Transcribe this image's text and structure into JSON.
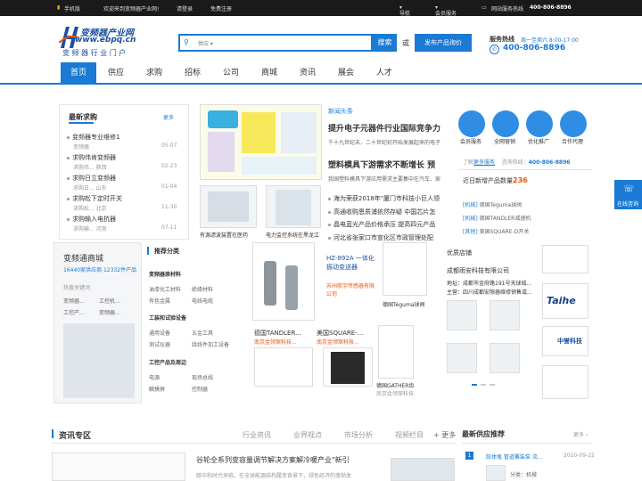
{
  "topbar": {
    "mobile": "手机版",
    "welcome": "欢迎来到变频器产业网!",
    "login": "请登录",
    "register": "免费注册",
    "nav": "导航",
    "member": "会员服务",
    "hotline_label": "网站服务热线",
    "hotline": "400-806-8896"
  },
  "logo": {
    "url": "www.ebpq.cn",
    "name": "变频器产业网",
    "slogan": "变 频 器 行 业 门 户"
  },
  "search": {
    "category": "供应",
    "button": "搜索",
    "or": "或",
    "publish": "发布产品询价"
  },
  "service": {
    "label": "服务热线",
    "hours": "周一至周六 8:00-17:00",
    "phone": "400-806-8896"
  },
  "nav": [
    "首页",
    "供应",
    "求购",
    "招标",
    "公司",
    "商城",
    "资讯",
    "展会",
    "人才"
  ],
  "latest_buy": {
    "title": "最新求购",
    "more": "更多",
    "items": [
      {
        "t": "变频器专业维修1",
        "s": "变频器",
        "d": "05-07"
      },
      {
        "t": "求购伟肯变频器",
        "s": "求购伟...  陕西",
        "d": "02-23"
      },
      {
        "t": "求购日立变频器",
        "s": "求购日...  山东",
        "d": "01-04"
      },
      {
        "t": "求购松下定时开关",
        "s": "求购松...  北京",
        "d": "11-30"
      },
      {
        "t": "求购输入电抗器",
        "s": "求购输...  河南",
        "d": "07-11"
      }
    ]
  },
  "center_imgs": [
    {
      "cap": "有源滤波装置在医药"
    },
    {
      "cap": "电力监控系统在黑龙江"
    }
  ],
  "headline": {
    "title": "新闻头条",
    "h1": "提升电子元器件行业国际竞争力",
    "h1s": "千十九世纪末，二十世纪初开始发展起来的电子",
    "h2": "塑料模具下游需求不断增长 预",
    "h2s": "我国塑料模具下游应用需求主要集中在汽车、家",
    "list": [
      "海为荣获2018年\"厦门市科技小巨人领",
      "高通收购恩质浦依然存疑 中国芯片怎",
      "晶电蓝光产品价格承压 提高四元产品",
      "河北省张家口市宣化区市政管理处配"
    ]
  },
  "services": [
    {
      "n": "会员服务"
    },
    {
      "n": "全网营销"
    },
    {
      "n": "优化推广"
    },
    {
      "n": "合作代理"
    }
  ],
  "more_service": {
    "pre": "了解",
    "link": "更多服务",
    "mid": "咨询热线：",
    "phone": "400-806-8896"
  },
  "new_products": {
    "label": "近日新增产品数量",
    "count": "236",
    "items": [
      {
        "tag": "[机械]",
        "t": "德国Teguma球阀"
      },
      {
        "tag": "[机械]",
        "t": "德国TANDLER减速机"
      },
      {
        "tag": "[其他]",
        "t": "美国SQUARE-D开关"
      }
    ]
  },
  "mall": {
    "title": "变频通商城",
    "stats": "16440家供应商  12332件产品",
    "hot_label": "热搜关键词",
    "hot": [
      "变频器...",
      "工控机...",
      "工控产...",
      "变频器..."
    ]
  },
  "recommend": {
    "title": "推荐分类",
    "groups": [
      {
        "name": "变频器原材料",
        "items": [
          "油漆化工材料",
          "绝缘材料",
          "有色金属",
          "电线电缆"
        ]
      },
      {
        "name": "工装和试验设备",
        "items": [
          "通用设备",
          "五金工具",
          "测试仪器",
          "绕线件加工设备"
        ]
      },
      {
        "name": "工控产品及周边",
        "items": [
          "电源",
          "现场总线",
          "触摸屏",
          "控制器"
        ]
      }
    ]
  },
  "products": [
    {
      "t": "HZ-892A 一体化振动变送器",
      "s": "苏州航宇传感器有限公司"
    },
    {
      "t": "德国Teguma球阀",
      "s": ""
    },
    {
      "t": "德国TANDLER...",
      "s": "南京金领琛科技..."
    },
    {
      "t": "美国SQUARE-...",
      "s": "南京金领琛科技..."
    },
    {
      "t": "德国GATHER齿",
      "s": "南京金领琛科技"
    }
  ],
  "quality": {
    "title": "优质店铺",
    "name": "成都雨安科技有限公司",
    "addr": "地址：成都市金府路191号天球城...",
    "biz": "主营：四川成都安限器维修销售或..."
  },
  "logos": [
    {
      "name": "Taihe"
    },
    {
      "name": "中誉科技"
    }
  ],
  "news": {
    "title": "资讯专区",
    "tabs": [
      "行业资讯",
      "业界视点",
      "市场分析",
      "视频栏目"
    ],
    "more": "+ 更多",
    "headline": "谷轮全系列变容量调节解决方案解冷暖产业\"新引",
    "sub": "碳中和时代来临，在全球能源结构履变背景下，绿色经济的蓬勃发"
  },
  "rec_supply": {
    "title": "最新供应推荐",
    "more": "更多",
    "item": "胶体瓶 管道雕装泵 流...",
    "date": "2020-09-22",
    "cat": "分类：机械"
  },
  "float": {
    "label": "在线咨询"
  }
}
